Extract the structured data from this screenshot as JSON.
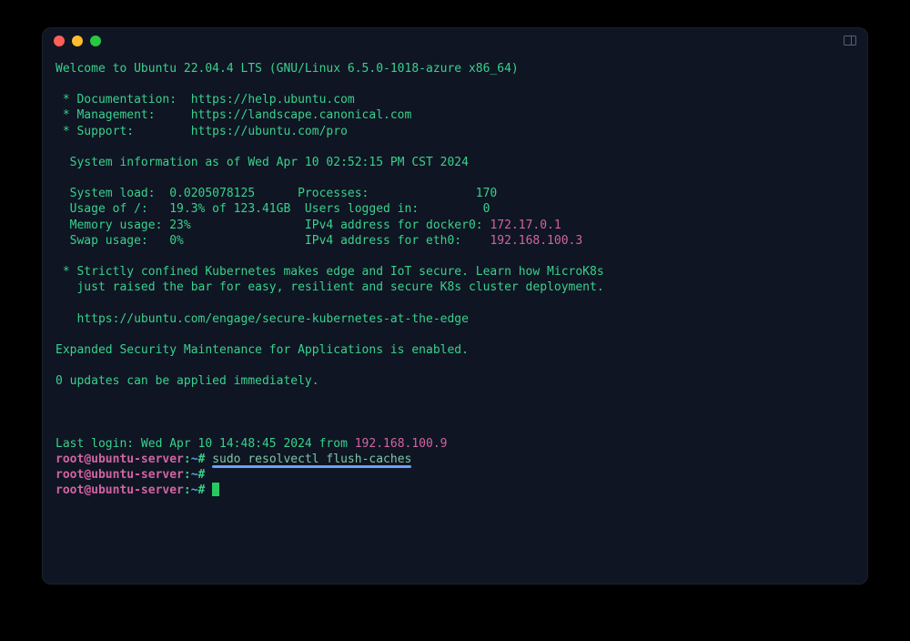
{
  "motd": {
    "welcome": "Welcome to Ubuntu 22.04.4 LTS (GNU/Linux 6.5.0-1018-azure x86_64)",
    "links": {
      "doc_label": " * Documentation:  https://help.ubuntu.com",
      "mgmt_label": " * Management:     https://landscape.canonical.com",
      "sup_label": " * Support:        https://ubuntu.com/pro"
    },
    "sysinfo_heading": "  System information as of Wed Apr 10 02:52:15 PM CST 2024",
    "rows": {
      "r1a": "  System load:  0.0205078125      Processes:               170",
      "r2a": "  Usage of /:   19.3% of 123.41GB  Users logged in:         0",
      "r3a": "  Memory usage: 23%                IPv4 address for docker0: ",
      "r3ip": "172.17.0.1",
      "r4a": "  Swap usage:   0%                 IPv4 address for eth0:    ",
      "r4ip": "192.168.100.3"
    },
    "k8s1": " * Strictly confined Kubernetes makes edge and IoT secure. Learn how MicroK8s",
    "k8s2": "   just raised the bar for easy, resilient and secure K8s cluster deployment.",
    "k8s3": "   https://ubuntu.com/engage/secure-kubernetes-at-the-edge",
    "esm": "Expanded Security Maintenance for Applications is enabled.",
    "updates": "0 updates can be applied immediately."
  },
  "lastlogin": {
    "prefix": "Last login: Wed Apr 10 14:48:45 2024 from ",
    "ip": "192.168.100.9"
  },
  "prompt": {
    "user": "root",
    "at": "@",
    "host": "ubuntu-server",
    "colon": ":",
    "path": "~",
    "hash": "# "
  },
  "command": "sudo resolvectl flush-caches"
}
